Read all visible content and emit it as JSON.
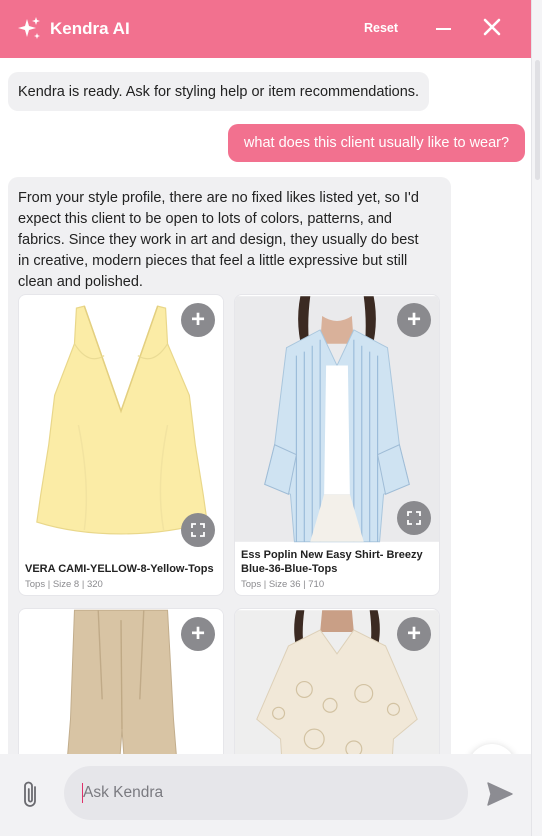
{
  "header": {
    "title": "Kendra AI",
    "reset_label": "Reset",
    "accent_color": "#f2718f",
    "icons": [
      "sparkle-icon",
      "minimize-icon",
      "close-icon"
    ]
  },
  "messages": {
    "intro": "Kendra is ready. Ask for styling help or item recommendations.",
    "user_question": "what does this client usually like to wear?",
    "bot_reply": "From your style profile, there are no fixed likes listed yet, so I'd expect this client to be open to lots of colors, patterns, and fabrics. Since they work in art and design, they usually do best in creative, modern pieces that feel a little expressive but still clean and polished."
  },
  "products": [
    {
      "name": "VERA CAMI-YELLOW-8-Yellow-Tops",
      "meta": "Tops | Size 8 | 320"
    },
    {
      "name": "Ess Poplin New Easy Shirt- Breezy Blue-36-Blue-Tops",
      "meta": "Tops | Size 36 | 710"
    },
    {
      "name": "",
      "meta": ""
    },
    {
      "name": "",
      "meta": ""
    }
  ],
  "composer": {
    "placeholder": "Ask Kendra",
    "icons": [
      "paperclip-icon",
      "send-icon"
    ]
  },
  "scroll_icon": "chevron-down-icon"
}
